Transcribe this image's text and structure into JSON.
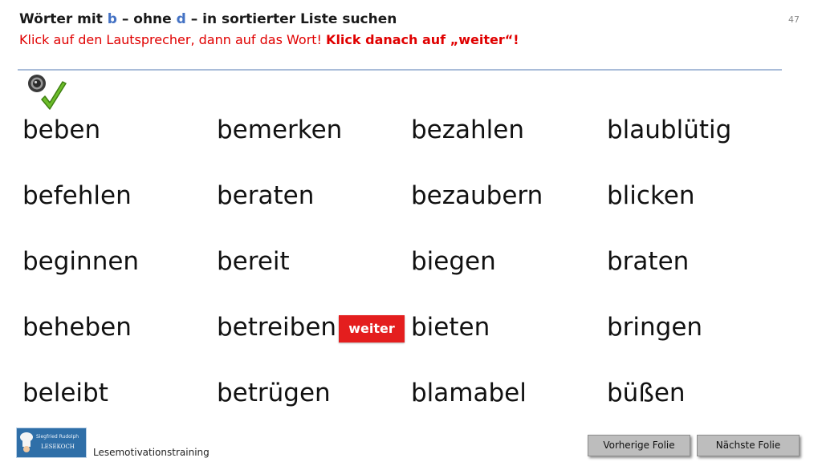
{
  "header": {
    "title_part1": "Wörter mit ",
    "title_b": "b",
    "title_part2": " – ohne ",
    "title_d": "d",
    "title_part3": " – in sortierter Liste suchen",
    "instruction_plain": "Klick auf den Lautsprecher, dann auf das Wort! ",
    "instruction_bold": "Klick danach auf „weiter“!",
    "slide_number": "47"
  },
  "words": {
    "col1": [
      "beben",
      "befehlen",
      "beginnen",
      "beheben",
      "beleibt"
    ],
    "col2": [
      "bemerken",
      "beraten",
      "bereit",
      "betreiben",
      "betrügen"
    ],
    "col3": [
      "bezahlen",
      "bezaubern",
      "biegen",
      "bieten",
      "blamabel"
    ],
    "col4": [
      "blaublütig",
      "blicken",
      "braten",
      "bringen",
      "büßen"
    ]
  },
  "weiter_label": "weiter",
  "footer": {
    "logo_line1": "Siegfried Rudolph",
    "logo_line2": "LESEKOCH",
    "label": "Lesemotivationstraining",
    "prev_button": "Vorherige  Folie",
    "next_button": "Nächste  Folie"
  },
  "colors": {
    "title_highlight": "#4472c4",
    "instruction": "#e00000",
    "weiter_button": "#e41e1e",
    "nav_button": "#bdbdbd",
    "rule": "#a9bcd9"
  },
  "icons": {
    "speaker": "speaker-icon",
    "checkmark": "checkmark-icon",
    "logo": "chef-hat-logo"
  }
}
